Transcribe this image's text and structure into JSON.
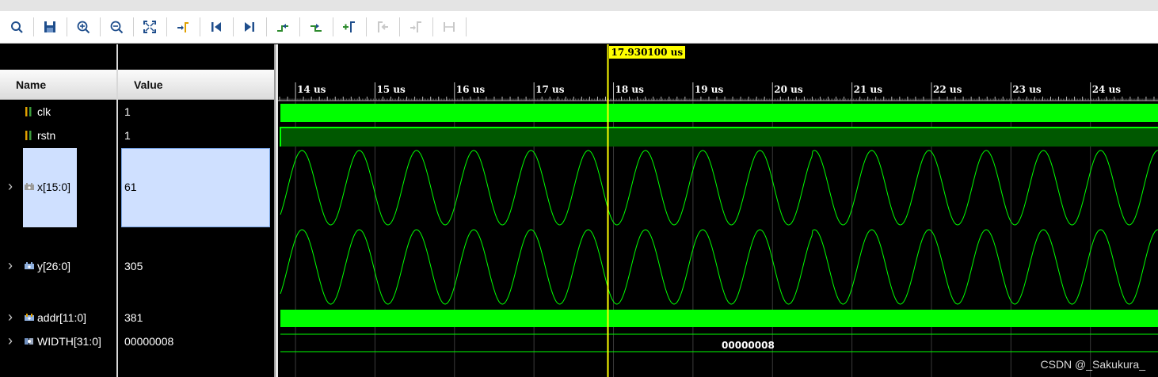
{
  "toolbar": {
    "buttons": [
      {
        "name": "search-icon",
        "enabled": true
      },
      {
        "name": "save-icon",
        "enabled": true
      },
      {
        "name": "zoom-in-icon",
        "enabled": true
      },
      {
        "name": "zoom-out-icon",
        "enabled": true
      },
      {
        "name": "zoom-fit-icon",
        "enabled": true
      },
      {
        "name": "go-to-cursor-icon",
        "enabled": true
      },
      {
        "name": "go-to-time-zero-icon",
        "enabled": true
      },
      {
        "name": "go-to-last-time-icon",
        "enabled": true
      },
      {
        "name": "previous-transition-icon",
        "enabled": true
      },
      {
        "name": "next-transition-icon",
        "enabled": true
      },
      {
        "name": "add-marker-icon",
        "enabled": true
      },
      {
        "name": "previous-marker-icon",
        "enabled": false
      },
      {
        "name": "next-marker-icon",
        "enabled": false
      },
      {
        "name": "swap-cursors-icon",
        "enabled": false
      }
    ]
  },
  "columns": {
    "name": "Name",
    "value": "Value"
  },
  "signals": [
    {
      "name": "clk",
      "value": "1",
      "icon": "bit-signal-icon",
      "expandable": false,
      "selected": false
    },
    {
      "name": "rstn",
      "value": "1",
      "icon": "bit-signal-icon",
      "expandable": false,
      "selected": false
    },
    {
      "name": "x[15:0]",
      "value": "61",
      "icon": "bus-signal-icon",
      "expandable": true,
      "selected": true
    },
    {
      "name": "y[26:0]",
      "value": "305",
      "icon": "bus-signal-icon",
      "expandable": true,
      "selected": false
    },
    {
      "name": "addr[11:0]",
      "value": "381",
      "icon": "bus-signal-icon",
      "expandable": true,
      "selected": false
    },
    {
      "name": "WIDTH[31:0]",
      "value": "00000008",
      "icon": "parameter-icon",
      "expandable": true,
      "selected": false
    }
  ],
  "timeline": {
    "unit": "us",
    "ticks": [
      {
        "t": 14,
        "label": "14 us"
      },
      {
        "t": 15,
        "label": "15 us"
      },
      {
        "t": 16,
        "label": "16 us"
      },
      {
        "t": 17,
        "label": "17 us"
      },
      {
        "t": 18,
        "label": "18 us"
      },
      {
        "t": 19,
        "label": "19 us"
      },
      {
        "t": 20,
        "label": "20 us"
      },
      {
        "t": 21,
        "label": "21 us"
      },
      {
        "t": 22,
        "label": "22 us"
      },
      {
        "t": 23,
        "label": "23 us"
      },
      {
        "t": 24,
        "label": "24 us"
      }
    ],
    "view_start_us": 13.78,
    "view_end_us": 24.85,
    "cursor": {
      "t": 17.9301,
      "label": "17.930100 us"
    }
  },
  "waves": {
    "sine_period_us": 0.72,
    "glitch_at_us": 20.5,
    "width_bus_value": "00000008"
  },
  "colors": {
    "wave_green": "#00ff00",
    "rstn_fill": "#005800",
    "cursor": "#ffff00",
    "grid": "#3a3a3a",
    "selection": "#cfe0ff"
  },
  "watermark": "CSDN @_Sakukura_"
}
